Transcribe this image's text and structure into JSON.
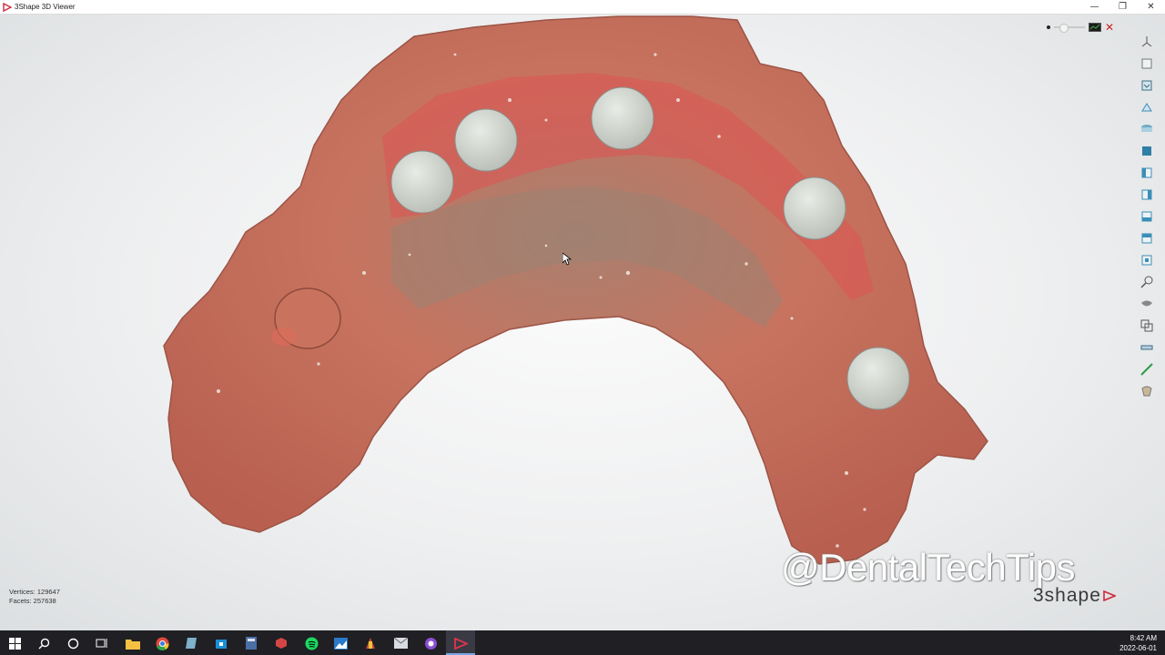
{
  "window": {
    "title": "3Shape 3D Viewer",
    "controls": {
      "minimize": "—",
      "restore": "❐",
      "close": "✕"
    }
  },
  "viewer": {
    "top_controls": {
      "close_symbol": "✕"
    },
    "toolbar": [
      "view-perspective-icon",
      "view-front-icon",
      "view-back-icon",
      "view-top-icon",
      "view-bottom-icon",
      "view-left-icon",
      "view-right-icon",
      "view-iso-icon",
      "view-box-icon",
      "view-box-alt-icon",
      "view-box-2-icon",
      "zoom-search-icon",
      "shading-icon",
      "transparency-icon",
      "measure-icon",
      "cross-section-icon",
      "texture-icon"
    ],
    "stats": {
      "vertices": "Vertices: 129647",
      "facets": "Facets: 257638"
    },
    "watermark": "@DentalTechTips",
    "brand": "3shape"
  },
  "taskbar": {
    "apps": [
      "start-icon",
      "search-icon",
      "cortana-icon",
      "task-view-icon",
      "file-explorer-icon",
      "chrome-icon",
      "notes-icon",
      "store-icon",
      "calculator-icon",
      "app-cube-icon",
      "spotify-icon",
      "photos-icon",
      "3d-tool-icon",
      "mail-icon",
      "app-ring-icon",
      "3shape-viewer-icon"
    ],
    "time": "8:42 AM",
    "date": "2022-06-01"
  },
  "colors": {
    "tissue": "#c96b5a",
    "tissue_red": "#e05050",
    "implant": "#cfd3cd",
    "taskbar": "#1f1f24",
    "close_red": "#cc2222",
    "toolbar_icon": "#3a8fb7"
  }
}
